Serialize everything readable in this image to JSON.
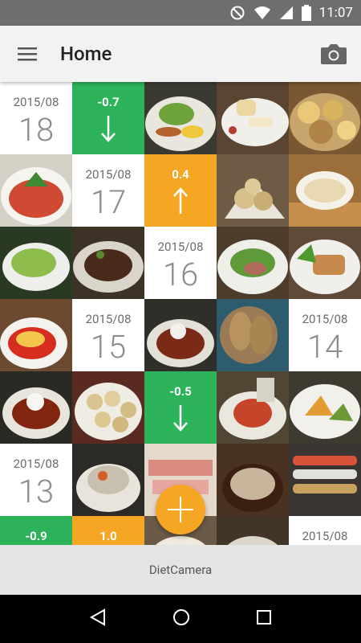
{
  "status_bar": {
    "time": "11:07"
  },
  "toolbar": {
    "title": "Home"
  },
  "footer": {
    "label": "DietCamera"
  },
  "dates": [
    {
      "ym": "2015/08",
      "day": "18"
    },
    {
      "ym": "2015/08",
      "day": "17"
    },
    {
      "ym": "2015/08",
      "day": "16"
    },
    {
      "ym": "2015/08",
      "day": "15"
    },
    {
      "ym": "2015/08",
      "day": "14"
    },
    {
      "ym": "2015/08",
      "day": "13"
    },
    {
      "ym": "2015/08",
      "day": ""
    }
  ],
  "changes": [
    {
      "value": "-0.7",
      "direction": "down",
      "color": "#2db35a"
    },
    {
      "value": "0.4",
      "direction": "up",
      "color": "#f5a623"
    },
    {
      "value": "-0.5",
      "direction": "down",
      "color": "#2db35a"
    },
    {
      "value": "-0.9",
      "direction": "down",
      "color": "#2db35a"
    },
    {
      "value": "1.0",
      "direction": "up",
      "color": "#f5a623"
    }
  ],
  "colors": {
    "accent": "#f5a623",
    "down": "#2db35a"
  }
}
